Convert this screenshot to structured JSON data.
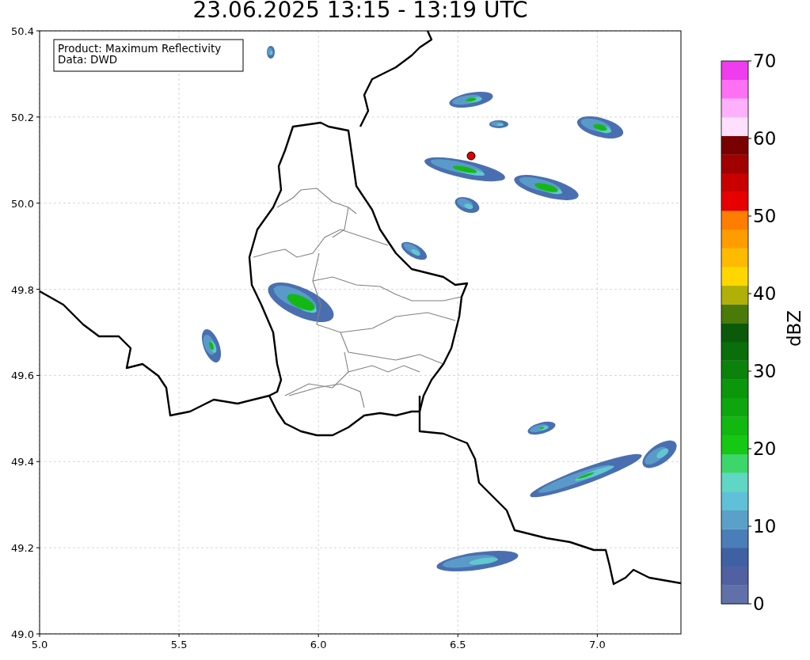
{
  "title": "23.06.2025 13:15 - 13:19 UTC",
  "legend": {
    "lines": [
      "Product: Maximum Reflectivity",
      "Data: DWD"
    ]
  },
  "x_axis": {
    "ticks": [
      "5.0",
      "5.5",
      "6.0",
      "6.5",
      "7.0"
    ]
  },
  "y_axis": {
    "ticks": [
      "50.4",
      "50.2",
      "50.0",
      "49.8",
      "49.6",
      "49.4",
      "49.2",
      "49.0"
    ]
  },
  "colorbar": {
    "label": "dBZ",
    "ticks": [
      "70",
      "60",
      "50",
      "40",
      "30",
      "20",
      "10",
      "0"
    ],
    "segments": [
      {
        "color": "#6070a8"
      },
      {
        "color": "#5060a0"
      },
      {
        "color": "#4060a4"
      },
      {
        "color": "#4a7eb8"
      },
      {
        "color": "#5aa0c8"
      },
      {
        "color": "#60c0d8"
      },
      {
        "color": "#60d6c4"
      },
      {
        "color": "#3cd66a"
      },
      {
        "color": "#14c814"
      },
      {
        "color": "#10b810"
      },
      {
        "color": "#0ea60e"
      },
      {
        "color": "#0c960c"
      },
      {
        "color": "#0b820b"
      },
      {
        "color": "#0a6e0a"
      },
      {
        "color": "#0a5a0a"
      },
      {
        "color": "#4a7a08"
      },
      {
        "color": "#b0b008"
      },
      {
        "color": "#ffd700"
      },
      {
        "color": "#ffbb00"
      },
      {
        "color": "#ff9c00"
      },
      {
        "color": "#ff7d00"
      },
      {
        "color": "#e60000"
      },
      {
        "color": "#c80000"
      },
      {
        "color": "#a00000"
      },
      {
        "color": "#780000"
      },
      {
        "color": "#ffe0fc"
      },
      {
        "color": "#ffb0fa"
      },
      {
        "color": "#ff70f5"
      },
      {
        "color": "#ee3cee"
      }
    ]
  }
}
